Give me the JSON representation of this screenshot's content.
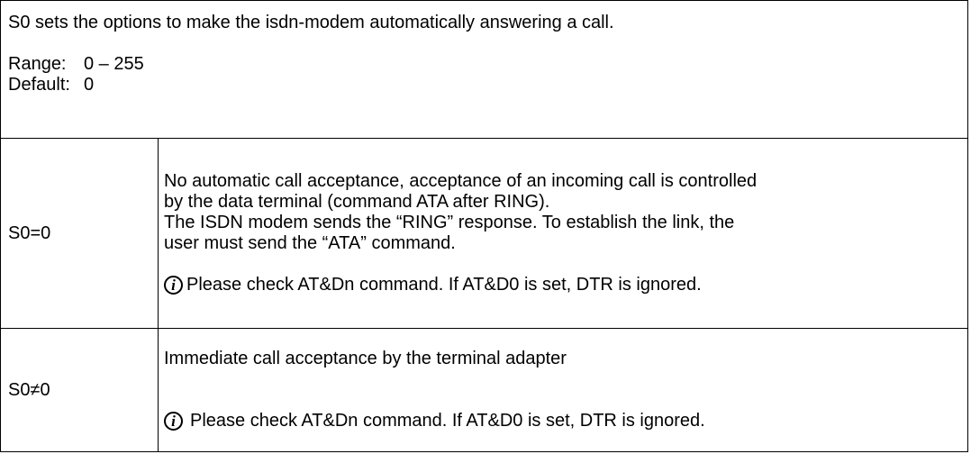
{
  "header": {
    "intro": "S0 sets the options to make the isdn-modem automatically answering a call.",
    "range_label": "Range:",
    "range_value": "0 – 255",
    "default_label": "Default:",
    "default_value": "0"
  },
  "rows": [
    {
      "label": "S0=0",
      "lines": [
        "No automatic call acceptance, acceptance of an incoming call is controlled",
        "by the data terminal (command ATA after RING).",
        "The ISDN modem sends the “RING” response. To establish the link, the",
        "user must send the “ATA” command."
      ],
      "note_icon": "info-icon",
      "note": "Please check AT&Dn command. If AT&D0 is set, DTR is ignored."
    },
    {
      "label": "S0≠0",
      "lines": [
        "Immediate call acceptance by the terminal adapter"
      ],
      "note_icon": "info-icon",
      "note": "Please check AT&Dn command. If AT&D0 is set, DTR is ignored."
    }
  ]
}
